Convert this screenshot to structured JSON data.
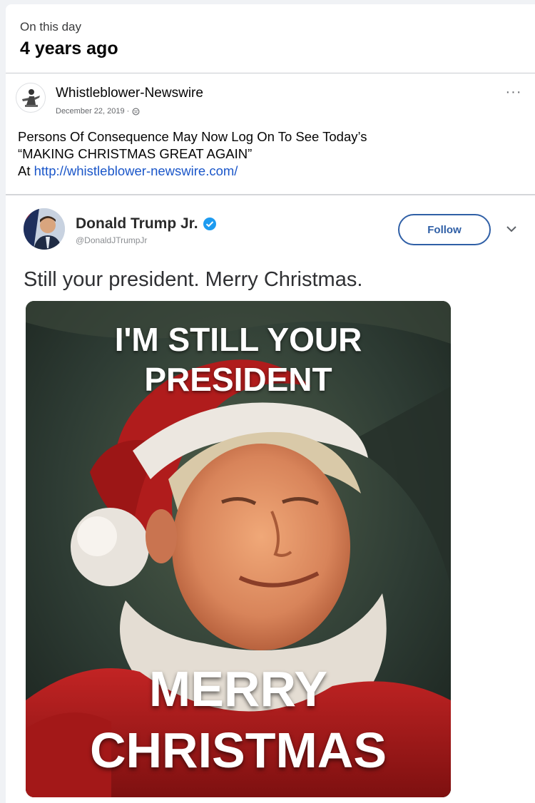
{
  "memory": {
    "label": "On this day",
    "title": "4 years ago"
  },
  "post": {
    "page_name": "Whistleblower-Newswire",
    "date": "December 22, 2019 ·",
    "privacy_icon": "globe-icon",
    "more_icon": "more-options-icon",
    "more_label": "···",
    "text_line1": "Persons Of Consequence May Now Log On To See Today’s",
    "text_line2": "“MAKING CHRISTMAS GREAT AGAIN”",
    "text_prefix": "At ",
    "link": "http://whistleblower-newswire.com/"
  },
  "tweet": {
    "name": "Donald Trump Jr.",
    "handle": "@DonaldJTrumpJr",
    "follow_label": "Follow",
    "text": "Still your president. Merry Christmas.",
    "image": {
      "top_line1": "I'M STILL YOUR",
      "top_line2": "PRESIDENT",
      "bottom_line1": "MERRY",
      "bottom_line2": "CHRISTMAS"
    }
  },
  "colors": {
    "link": "#1a56c9",
    "follow_border": "#2f5fa6",
    "verified": "#1d9bf0",
    "santa_red": "#b01c1c"
  }
}
